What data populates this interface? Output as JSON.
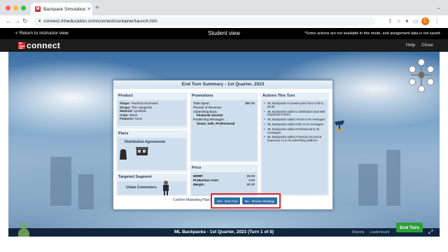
{
  "browser": {
    "tab_title": "Backpack Simulation - Practice",
    "tab_favicon": "M",
    "url": "connect.mheducation.com/connect/container/launch.htm"
  },
  "student_view_bar": {
    "back_link": "< Return to instructor view",
    "title": "Student view",
    "note": "*Some actions are not available in this mode, and assignment data is not saved."
  },
  "header": {
    "logo_text": "connect",
    "logo_mark": "Mc Graw Hill",
    "help": "Help",
    "close": "Close"
  },
  "modal": {
    "title": "End Turn Summary - 1st Quarter, 2023",
    "product": {
      "heading": "Product",
      "lines": [
        {
          "k": "Shape:",
          "v": "Teardrop Rucksack"
        },
        {
          "k": "Straps:",
          "v": "Thin Spaghetti"
        },
        {
          "k": "Material:",
          "v": "Synthetic"
        },
        {
          "k": "Color:",
          "v": "Black"
        },
        {
          "k": "Features:",
          "v": "None"
        }
      ]
    },
    "place": {
      "heading": "Place",
      "label": "Distribution Agreements"
    },
    "targeted": {
      "heading": "Targeted Segment",
      "label": "Urban Commuters"
    },
    "promotions": {
      "heading": "Promotions",
      "total_spent_label": "Total Spent:",
      "total_spent_value": "$50.00",
      "percent_label": "Percent of Revenue:",
      "buys_label": "Advertising Buys:",
      "buys_value": "Financial Journal",
      "messages_label": "Positioning Messages:",
      "messages_value": "Smart, Safe, Professional"
    },
    "price": {
      "heading": "Price",
      "msrp_label": "MSRP:",
      "msrp_value": "69.00",
      "cost_label": "Production Cost:",
      "cost_value": "9.00",
      "margin_label": "Margin:",
      "margin_value": "60.00"
    },
    "actions": {
      "heading": "Actions This Turn",
      "items": [
        "ML Backpacks increases price from 0.00 to 69.00",
        "ML Backpacks added a distribution deal with Department Store",
        "ML Backpacks added Smart to its messages",
        "ML Backpacks added Safe to its messages",
        "ML Backpacks added Professional to its messages",
        "ML Backpacks added Financial Journal at frequency 1x to its advertising platform"
      ]
    },
    "confirm_text": "Confirm Marketing Plan?",
    "yes_button": "Yes - End Turn",
    "no_button": "No - Revise Strategy"
  },
  "bottom_bar": {
    "status": "ML Backpacks - 1st Quarter, 2023 (Turn 1 of 8)",
    "reports": "Reports",
    "leaderboard": "Leaderboard",
    "end_turn": "End Turn"
  },
  "colors": {
    "highlight": "#e0262e",
    "end_turn_green": "#2e9e3a",
    "button_blue": "#2f6da3"
  }
}
